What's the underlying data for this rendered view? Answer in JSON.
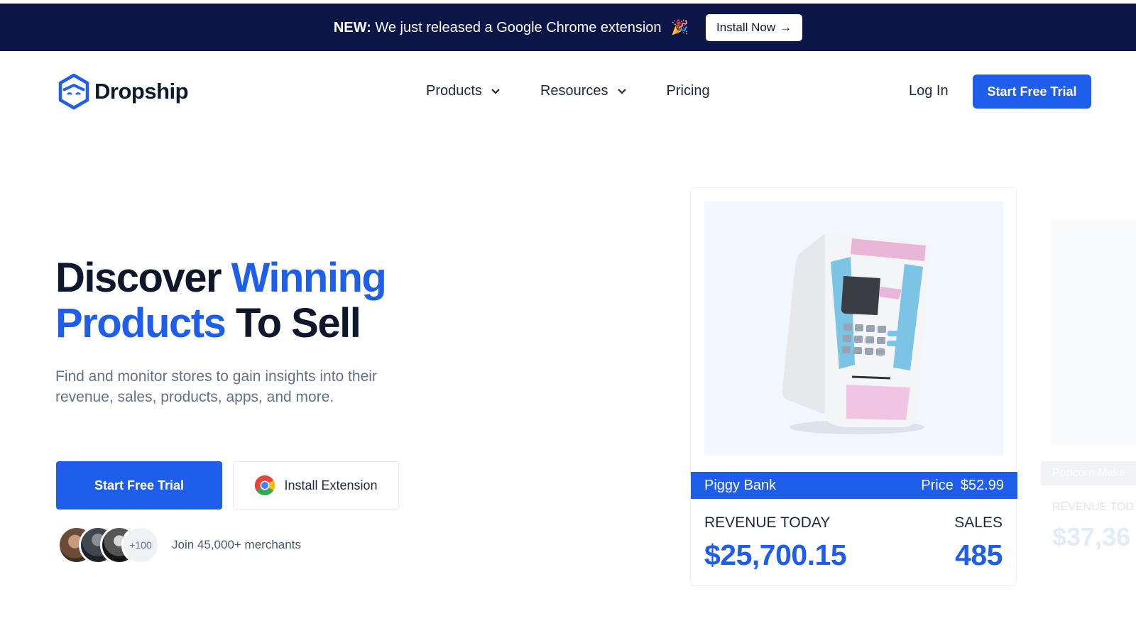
{
  "announcement": {
    "prefix": "NEW:",
    "message": "We just released a Google Chrome extension",
    "emoji": "🎉",
    "button_label": "Install Now",
    "button_arrow": "→"
  },
  "nav": {
    "brand": "Dropship",
    "menu": [
      {
        "label": "Products",
        "has_dropdown": true
      },
      {
        "label": "Resources",
        "has_dropdown": true
      },
      {
        "label": "Pricing",
        "has_dropdown": false
      }
    ],
    "login_label": "Log In",
    "cta_label": "Start Free Trial"
  },
  "hero": {
    "title_part1": "Discover ",
    "title_highlight1": "Winning",
    "title_highlight2": "Products",
    "title_part2": " To Sell",
    "subtitle": "Find and monitor stores to gain insights into their revenue, sales, products, apps, and more.",
    "primary_cta": "Start Free Trial",
    "secondary_cta": "Install Extension",
    "avatar_more": "+100",
    "merchants_text": "Join 45,000+ merchants"
  },
  "product_card": {
    "name": "Piggy Bank",
    "price_label": "Price",
    "price": "$52.99",
    "revenue_label": "REVENUE TODAY",
    "revenue": "$25,700.15",
    "sales_label": "SALES",
    "sales": "485"
  },
  "next_card": {
    "name": "Popcorn Make",
    "revenue_label": "REVENUE TOD",
    "revenue": "$37,36"
  },
  "colors": {
    "accent": "#1f5eea",
    "topbar": "#0b1547",
    "text_dark": "#0f172a",
    "text_muted": "#64708a"
  }
}
